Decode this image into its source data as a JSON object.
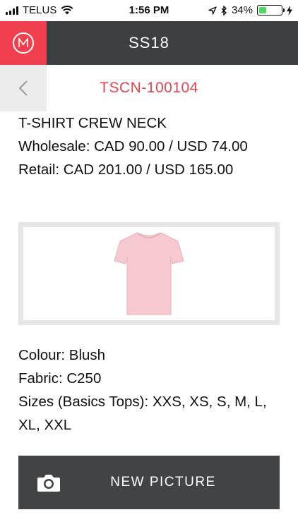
{
  "status_bar": {
    "carrier": "TELUS",
    "time": "1:56 PM",
    "battery": "34%",
    "battery_level": 0.34,
    "icons": [
      "signal-icon",
      "wifi-icon",
      "location-icon",
      "bluetooth-icon",
      "battery-icon",
      "charging-icon"
    ]
  },
  "header": {
    "title": "SS18",
    "accent_color": "#f0404f",
    "bar_color": "#3e3f41"
  },
  "product": {
    "sku": "TSCN-100104",
    "name": "T-SHIRT CREW NECK",
    "wholesale": "Wholesale: CAD 90.00 / USD 74.00",
    "retail": "Retail: CAD 201.00 / USD 165.00",
    "image_icon": "tshirt-image",
    "shirt_color": "#f6c9d1",
    "colour": "Colour: Blush",
    "fabric": "Fabric: C250",
    "sizes": "Sizes (Basics Tops): XXS, XS, S, M, L, XL, XXL"
  },
  "actions": {
    "new_picture_label": "NEW PICTURE",
    "new_picture_icon": "camera-icon"
  }
}
